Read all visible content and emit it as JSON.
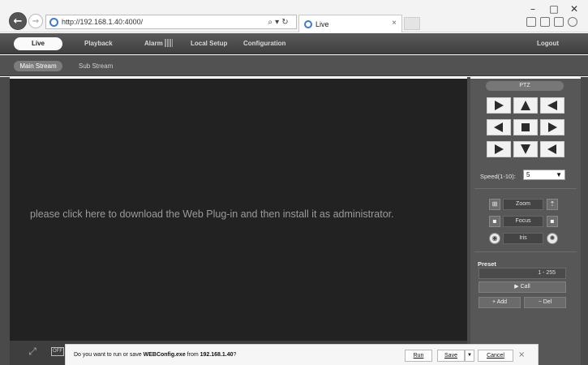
{
  "browser": {
    "url": "http://192.168.1.40:4000/",
    "search_label": "⌕ ▾ ↻",
    "tab_title": "Live",
    "tab_close": "×",
    "window_controls": {
      "minimize": "–",
      "maximize": "□",
      "close": "✕"
    },
    "toolbar_icons": [
      "home-icon",
      "star-icon",
      "settings-icon",
      "smiley-icon"
    ]
  },
  "nav": {
    "live": "Live",
    "playback": "Playback",
    "alarm": "Alarm",
    "local_setup": "Local Setup",
    "configuration": "Configuration",
    "logout": "Logout"
  },
  "streams": {
    "main": "Main Stream",
    "sub": "Sub Stream"
  },
  "video": {
    "message": "please click here to download the Web Plug-in and then install it as administrator.",
    "osd_label": "OFF"
  },
  "ptz": {
    "title": "PTZ",
    "speed_label": "Speed(1-10):",
    "speed_value": "5",
    "zoom_label": "Zoom",
    "focus_label": "Focus",
    "iris_label": "Iris",
    "preset_label": "Preset",
    "preset_range": "1 - 255",
    "call_label": "▶  Call",
    "add_label": "+  Add",
    "del_label": "−  Del"
  },
  "notification": {
    "prefix": "Do you want to run or save ",
    "filename": "WEBConfig.exe",
    "middle": " from ",
    "host": "192.168.1.40",
    "suffix": "?",
    "run_label": "Run",
    "save_label": "Save",
    "cancel_label": "Cancel",
    "close_label": "×"
  },
  "colors": {
    "video_bg": "#222222",
    "panel_bg": "#575757",
    "nav_bg": "#4a4a4a",
    "active_tab": "#fafafa"
  }
}
